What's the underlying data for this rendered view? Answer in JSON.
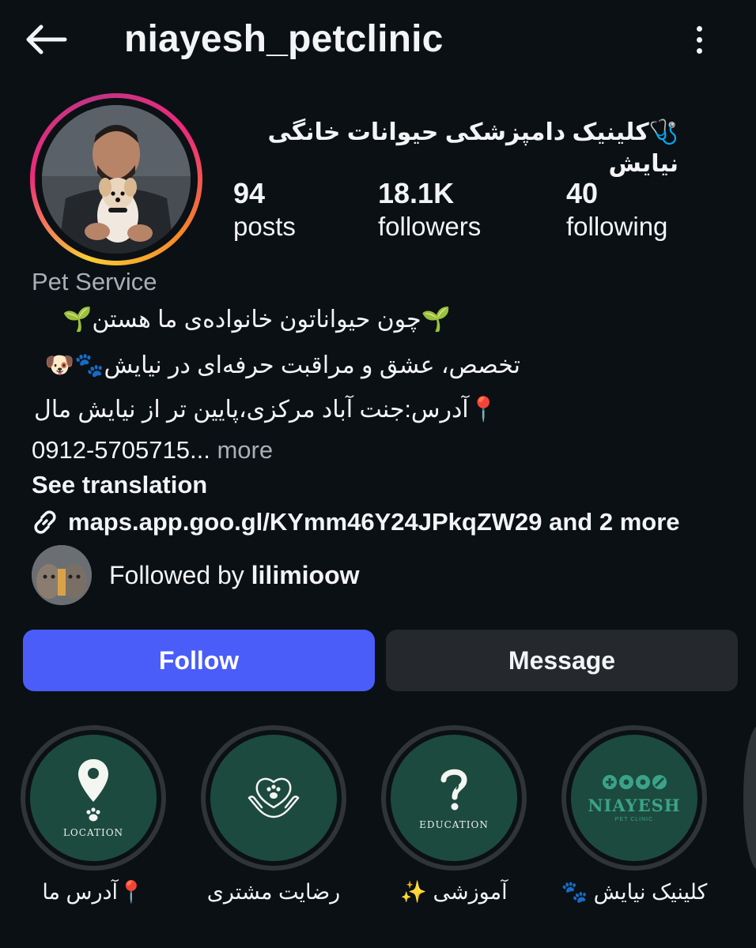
{
  "header": {
    "username": "niayesh_petclinic"
  },
  "profile": {
    "full_name": "🩺کلینیک دامپزشکی حیوانات خانگی نیایش",
    "stats": [
      {
        "value": "94",
        "label": "posts"
      },
      {
        "value": "18.1K",
        "label": "followers"
      },
      {
        "value": "40",
        "label": "following"
      }
    ],
    "category": "Pet Service",
    "bio": {
      "line1": "🌱چون حیواناتون خانواده‌ی ما هستن🌱",
      "line2": "تخصص، عشق و مراقبت حرفه‌ای در نیایش🐾🐶",
      "line3": "📍آدرس:جنت آباد مرکزی،پایین تر از نیایش مال",
      "phone": "0912-5705715...",
      "more": "more"
    },
    "see_translation": "See translation",
    "link_text": "maps.app.goo.gl/KYmm46Y24JPkqZW29 and 2 more",
    "followed_by_prefix": "Followed by",
    "followed_by_user": "lilimioow"
  },
  "actions": {
    "follow": "Follow",
    "message": "Message"
  },
  "highlights": [
    {
      "caption": "📍آدرس ما",
      "inner_text": "LOCATION",
      "icon": "location-pin-icon"
    },
    {
      "caption": "رضایت مشتری",
      "inner_text": "",
      "icon": "paw-in-hands-icon"
    },
    {
      "caption": "آموزشی ✨",
      "inner_text": "EDUCATION",
      "icon": "question-mark-icon"
    },
    {
      "caption": "کلینیک نیایش 🐾",
      "inner_text": "NIAYESH",
      "inner_sub": "PET CLINIC",
      "icon": "niayesh-logo-icon"
    }
  ],
  "colors": {
    "background": "#0b1014",
    "follow_button": "#4a5df9",
    "message_button": "#25292e",
    "highlight_fill": "#1d4a3e"
  }
}
